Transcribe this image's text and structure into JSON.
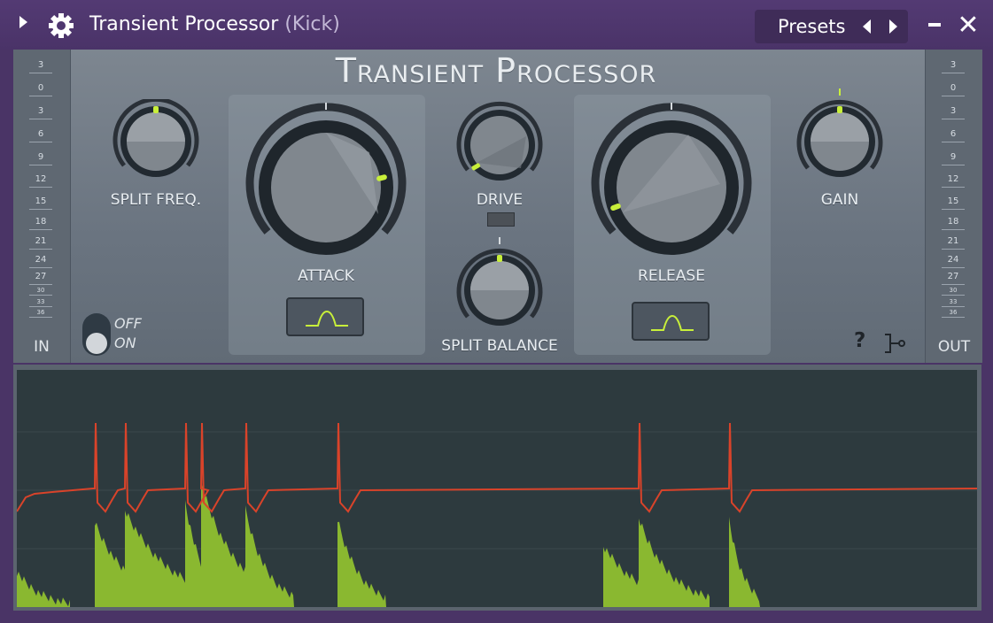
{
  "titlebar": {
    "title": "Transient Processor",
    "subtitle": "(Kick)",
    "presets_label": "Presets",
    "close_glyph": "✕"
  },
  "plugin": {
    "title": "Transient Processor"
  },
  "meters": {
    "in_label": "IN",
    "out_label": "OUT",
    "scale": [
      "3",
      "0",
      "3",
      "6",
      "9",
      "12",
      "15",
      "18",
      "21",
      "24",
      "27",
      "30",
      "33",
      "36"
    ]
  },
  "knobs": {
    "split_freq": {
      "label": "SPLIT FREQ."
    },
    "attack": {
      "label": "ATTACK"
    },
    "drive": {
      "label": "DRIVE"
    },
    "split_balance": {
      "label": "SPLIT BALANCE"
    },
    "release": {
      "label": "RELEASE"
    },
    "gain": {
      "label": "GAIN"
    }
  },
  "toggle": {
    "off_label": "OFF",
    "on_label": "ON"
  },
  "help_glyph": "?",
  "colors": {
    "accent_green": "#c8ef3a",
    "waveform_fill": "#8ab830",
    "gain_line": "#d9432a",
    "titlebar": "#4a3368"
  }
}
